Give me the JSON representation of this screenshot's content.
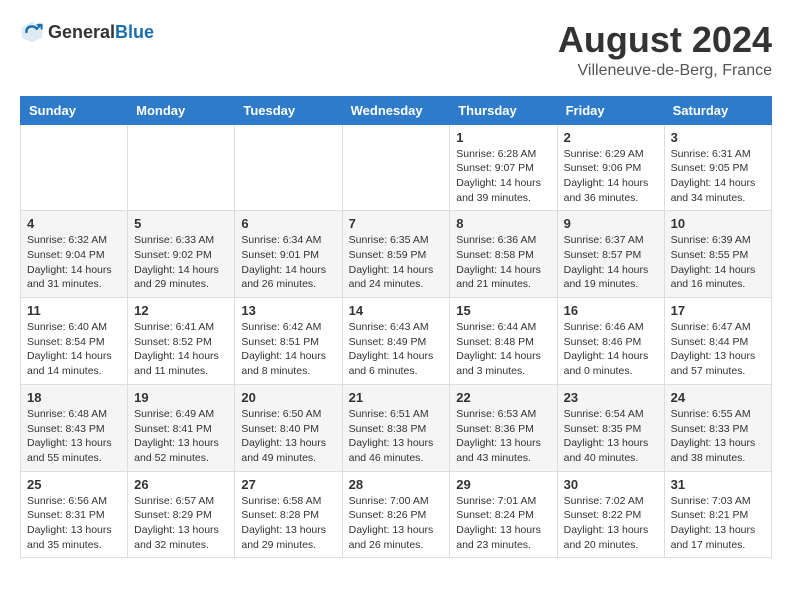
{
  "header": {
    "logo_general": "General",
    "logo_blue": "Blue",
    "month_year": "August 2024",
    "location": "Villeneuve-de-Berg, France"
  },
  "days_of_week": [
    "Sunday",
    "Monday",
    "Tuesday",
    "Wednesday",
    "Thursday",
    "Friday",
    "Saturday"
  ],
  "weeks": [
    [
      {
        "day": "",
        "info": ""
      },
      {
        "day": "",
        "info": ""
      },
      {
        "day": "",
        "info": ""
      },
      {
        "day": "",
        "info": ""
      },
      {
        "day": "1",
        "info": "Sunrise: 6:28 AM\nSunset: 9:07 PM\nDaylight: 14 hours\nand 39 minutes."
      },
      {
        "day": "2",
        "info": "Sunrise: 6:29 AM\nSunset: 9:06 PM\nDaylight: 14 hours\nand 36 minutes."
      },
      {
        "day": "3",
        "info": "Sunrise: 6:31 AM\nSunset: 9:05 PM\nDaylight: 14 hours\nand 34 minutes."
      }
    ],
    [
      {
        "day": "4",
        "info": "Sunrise: 6:32 AM\nSunset: 9:04 PM\nDaylight: 14 hours\nand 31 minutes."
      },
      {
        "day": "5",
        "info": "Sunrise: 6:33 AM\nSunset: 9:02 PM\nDaylight: 14 hours\nand 29 minutes."
      },
      {
        "day": "6",
        "info": "Sunrise: 6:34 AM\nSunset: 9:01 PM\nDaylight: 14 hours\nand 26 minutes."
      },
      {
        "day": "7",
        "info": "Sunrise: 6:35 AM\nSunset: 8:59 PM\nDaylight: 14 hours\nand 24 minutes."
      },
      {
        "day": "8",
        "info": "Sunrise: 6:36 AM\nSunset: 8:58 PM\nDaylight: 14 hours\nand 21 minutes."
      },
      {
        "day": "9",
        "info": "Sunrise: 6:37 AM\nSunset: 8:57 PM\nDaylight: 14 hours\nand 19 minutes."
      },
      {
        "day": "10",
        "info": "Sunrise: 6:39 AM\nSunset: 8:55 PM\nDaylight: 14 hours\nand 16 minutes."
      }
    ],
    [
      {
        "day": "11",
        "info": "Sunrise: 6:40 AM\nSunset: 8:54 PM\nDaylight: 14 hours\nand 14 minutes."
      },
      {
        "day": "12",
        "info": "Sunrise: 6:41 AM\nSunset: 8:52 PM\nDaylight: 14 hours\nand 11 minutes."
      },
      {
        "day": "13",
        "info": "Sunrise: 6:42 AM\nSunset: 8:51 PM\nDaylight: 14 hours\nand 8 minutes."
      },
      {
        "day": "14",
        "info": "Sunrise: 6:43 AM\nSunset: 8:49 PM\nDaylight: 14 hours\nand 6 minutes."
      },
      {
        "day": "15",
        "info": "Sunrise: 6:44 AM\nSunset: 8:48 PM\nDaylight: 14 hours\nand 3 minutes."
      },
      {
        "day": "16",
        "info": "Sunrise: 6:46 AM\nSunset: 8:46 PM\nDaylight: 14 hours\nand 0 minutes."
      },
      {
        "day": "17",
        "info": "Sunrise: 6:47 AM\nSunset: 8:44 PM\nDaylight: 13 hours\nand 57 minutes."
      }
    ],
    [
      {
        "day": "18",
        "info": "Sunrise: 6:48 AM\nSunset: 8:43 PM\nDaylight: 13 hours\nand 55 minutes."
      },
      {
        "day": "19",
        "info": "Sunrise: 6:49 AM\nSunset: 8:41 PM\nDaylight: 13 hours\nand 52 minutes."
      },
      {
        "day": "20",
        "info": "Sunrise: 6:50 AM\nSunset: 8:40 PM\nDaylight: 13 hours\nand 49 minutes."
      },
      {
        "day": "21",
        "info": "Sunrise: 6:51 AM\nSunset: 8:38 PM\nDaylight: 13 hours\nand 46 minutes."
      },
      {
        "day": "22",
        "info": "Sunrise: 6:53 AM\nSunset: 8:36 PM\nDaylight: 13 hours\nand 43 minutes."
      },
      {
        "day": "23",
        "info": "Sunrise: 6:54 AM\nSunset: 8:35 PM\nDaylight: 13 hours\nand 40 minutes."
      },
      {
        "day": "24",
        "info": "Sunrise: 6:55 AM\nSunset: 8:33 PM\nDaylight: 13 hours\nand 38 minutes."
      }
    ],
    [
      {
        "day": "25",
        "info": "Sunrise: 6:56 AM\nSunset: 8:31 PM\nDaylight: 13 hours\nand 35 minutes."
      },
      {
        "day": "26",
        "info": "Sunrise: 6:57 AM\nSunset: 8:29 PM\nDaylight: 13 hours\nand 32 minutes."
      },
      {
        "day": "27",
        "info": "Sunrise: 6:58 AM\nSunset: 8:28 PM\nDaylight: 13 hours\nand 29 minutes."
      },
      {
        "day": "28",
        "info": "Sunrise: 7:00 AM\nSunset: 8:26 PM\nDaylight: 13 hours\nand 26 minutes."
      },
      {
        "day": "29",
        "info": "Sunrise: 7:01 AM\nSunset: 8:24 PM\nDaylight: 13 hours\nand 23 minutes."
      },
      {
        "day": "30",
        "info": "Sunrise: 7:02 AM\nSunset: 8:22 PM\nDaylight: 13 hours\nand 20 minutes."
      },
      {
        "day": "31",
        "info": "Sunrise: 7:03 AM\nSunset: 8:21 PM\nDaylight: 13 hours\nand 17 minutes."
      }
    ]
  ]
}
